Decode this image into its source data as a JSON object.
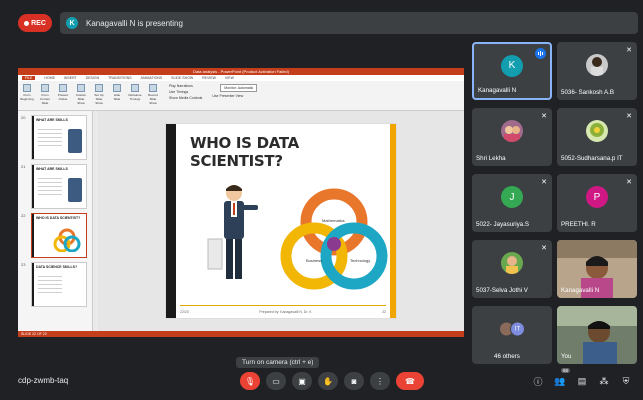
{
  "recording": {
    "label": "REC"
  },
  "presenter_bar": {
    "initial": "K",
    "text": "Kanagavalli N is presenting"
  },
  "presentation": {
    "window_title": "Data analysis - PowerPoint (Product Activation Failed)",
    "ribbon_tabs": [
      "FILE",
      "HOME",
      "INSERT",
      "DESIGN",
      "TRANSITIONS",
      "ANIMATIONS",
      "SLIDE SHOW",
      "REVIEW",
      "VIEW"
    ],
    "active_tab": "SLIDE SHOW",
    "ribbon_buttons": [
      "From Beginning",
      "From Current Slide",
      "Present Online",
      "Custom Slide Show",
      "Set Up Slide Show",
      "Hide Slide",
      "Rehearse Timings",
      "Record Slide Show"
    ],
    "ribbon_checks": [
      "Play Narrations",
      "Use Timings",
      "Show Media Controls"
    ],
    "monitor_label": "Monitor: Automatic",
    "presenter_view": "Use Presenter View",
    "thumbnails": [
      {
        "num": "20",
        "title": "WHAT ARE SKILLS",
        "selected": false
      },
      {
        "num": "21",
        "title": "WHAT ARE SKILLS",
        "selected": false
      },
      {
        "num": "22",
        "title": "WHO IS DATA SCIENTIST?",
        "selected": true
      },
      {
        "num": "23",
        "title": "DATA SCIENCE SKILLS?",
        "selected": false
      }
    ],
    "slide_title": "WHO IS DATA SCIENTIST?",
    "venn_labels": [
      "Mathematics",
      "Business",
      "Technology"
    ],
    "slide_footer_left": "22/23",
    "slide_footer_mid": "Prepared by: Kanagavalli N, Dr. K",
    "slide_footer_right": "22",
    "status_text": "SLIDE 22 OF 23"
  },
  "participants": [
    {
      "name": "Kanagavalli N",
      "type": "initial",
      "initial": "K",
      "color": "#129eaf",
      "speaking": true
    },
    {
      "name": "5036- Sankosh A.B",
      "type": "photo",
      "muted": true
    },
    {
      "name": "Shri Lekha",
      "type": "photo",
      "muted": true
    },
    {
      "name": "5052-Sudharsana.p IT",
      "type": "photo",
      "muted": true
    },
    {
      "name": "5022- Jayasuriya.S",
      "type": "initial",
      "initial": "J",
      "color": "#34a853",
      "muted": true
    },
    {
      "name": "PREETHI. R",
      "type": "initial",
      "initial": "P",
      "color": "#d01884",
      "muted": true
    },
    {
      "name": "5037-Selva Jothi V",
      "type": "photo",
      "muted": true
    },
    {
      "name": "Kanagavalli N",
      "type": "video",
      "muted": false
    },
    {
      "name": "46 others",
      "type": "others",
      "initials": [
        "",
        "IT"
      ]
    },
    {
      "name": "You",
      "type": "video"
    }
  ],
  "tooltip": "Turn on camera (ctrl + e)",
  "meeting_code": "cdp-zwmb-taq",
  "people_count": "56",
  "controls": [
    "mic-off",
    "camera-off",
    "captions",
    "raise-hand",
    "present",
    "more",
    "leave-call"
  ],
  "colors": {
    "background": "#202124",
    "tile": "#3c4043",
    "danger": "#ea4335",
    "accent": "#8ab4f8",
    "powerpoint": "#c43e1c"
  }
}
